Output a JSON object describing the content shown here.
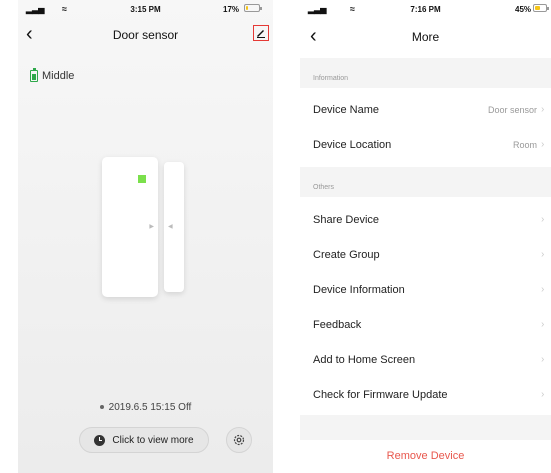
{
  "left": {
    "status": {
      "time": "3:15 PM",
      "battery": "17%",
      "battery_level": 0.17,
      "battery_color": "#f5c518"
    },
    "nav": {
      "title": "Door sensor"
    },
    "battery_level_text": "Middle",
    "last_event": "2019.6.5 15:15 Off",
    "view_more_label": "Click to view more",
    "icons": [
      "back-icon",
      "edit-icon",
      "battery-icon",
      "clock-icon",
      "settings-icon"
    ]
  },
  "right": {
    "status": {
      "time": "7:16 PM",
      "battery": "45%",
      "battery_level": 0.45,
      "battery_color": "#f5c518"
    },
    "nav": {
      "title": "More"
    },
    "sections": {
      "information": "Information",
      "others": "Others"
    },
    "info_rows": [
      {
        "label": "Device Name",
        "value": "Door sensor"
      },
      {
        "label": "Device Location",
        "value": "Room"
      }
    ],
    "other_rows": [
      {
        "label": "Share Device"
      },
      {
        "label": "Create Group"
      },
      {
        "label": "Device Information"
      },
      {
        "label": "Feedback"
      },
      {
        "label": "Add to Home Screen"
      },
      {
        "label": "Check for Firmware Update"
      }
    ],
    "remove_label": "Remove Device",
    "remove_color": "#e8574d"
  }
}
